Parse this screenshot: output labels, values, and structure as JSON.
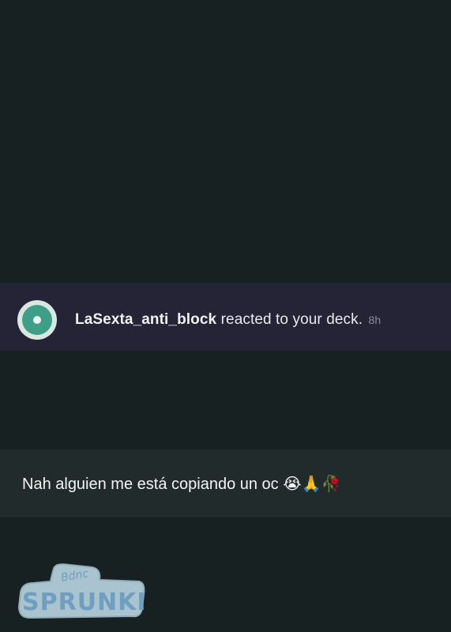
{
  "notification": {
    "username": "LaSexta_anti_block",
    "message": " reacted to your deck.",
    "time": "8h"
  },
  "caption": {
    "text": "Nah alguien me está copiando un oc 😭🙏🥀"
  },
  "sticker": {
    "small_text": "Bdnc",
    "big_text": "SPRUNKI"
  },
  "colors": {
    "background": "#172121",
    "notification_bg": "#252436",
    "caption_bg": "#222b2c",
    "avatar_ring": "#3f9e88",
    "sticker_fill": "#a9c3cf",
    "sticker_text": "#6f9ec0"
  }
}
